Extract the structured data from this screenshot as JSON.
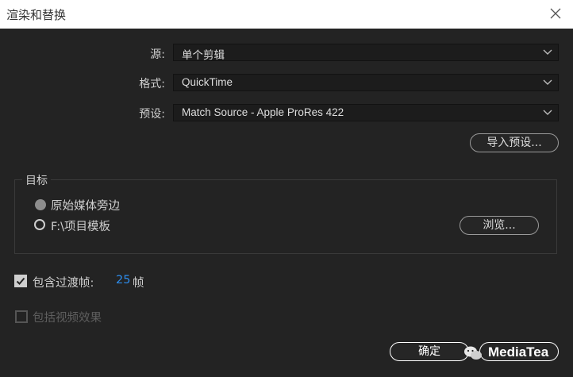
{
  "window": {
    "title": "渲染和替换"
  },
  "form": {
    "source_label": "源:",
    "source_value": "单个剪辑",
    "format_label": "格式:",
    "format_value": "QuickTime",
    "preset_label": "预设:",
    "preset_value": "Match Source - Apple ProRes 422",
    "import_preset_button": "导入预设..."
  },
  "target": {
    "group_title": "目标",
    "option_original": "原始媒体旁边",
    "option_path": "F:\\项目模板",
    "browse_button": "浏览..."
  },
  "options": {
    "include_handles_label": "包含过渡帧:",
    "handles_value": "25",
    "handles_unit": "帧",
    "include_effects_label": "包括视频效果"
  },
  "footer": {
    "ok_button": "确定",
    "watermark": "MediaTea"
  },
  "colors": {
    "background": "#232323",
    "titlebar": "#ffffff",
    "accent_blue": "#2d8ceb"
  }
}
